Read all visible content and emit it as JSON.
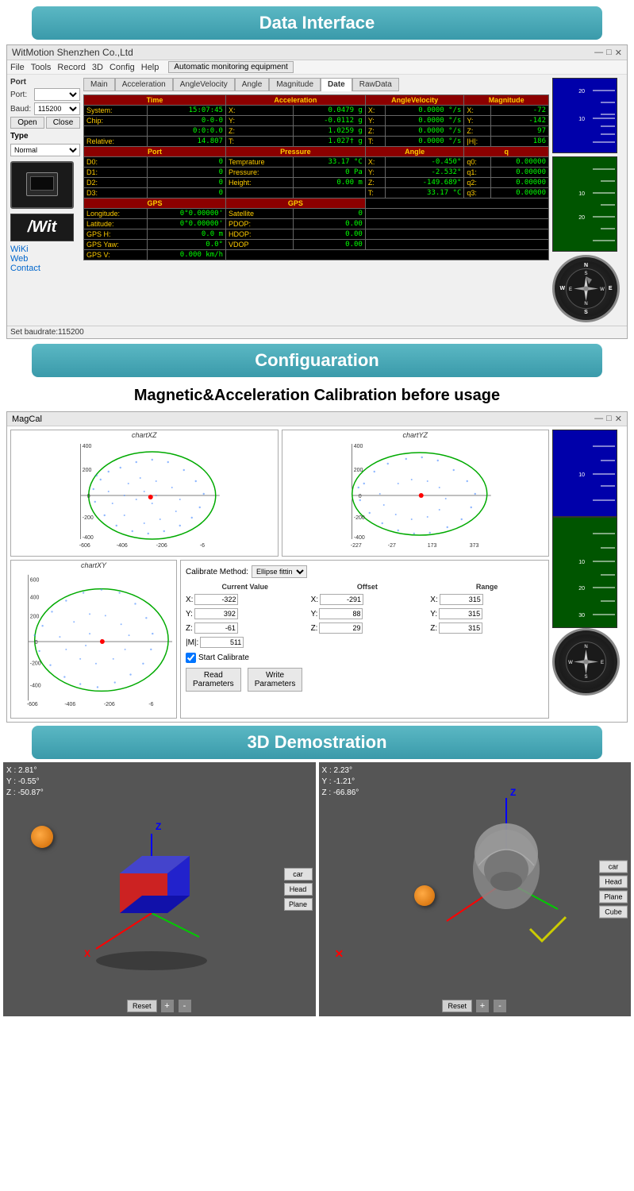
{
  "page": {
    "sections": [
      "Data Interface",
      "Configuaration",
      "3D Demostration"
    ]
  },
  "dataInterface": {
    "sectionTitle": "Data Interface",
    "window": {
      "title": "WitMotion Shenzhen Co.,Ltd",
      "controls": [
        "—",
        "□",
        "✕"
      ]
    },
    "menu": {
      "items": [
        "File",
        "Tools",
        "Record",
        "3D",
        "Config",
        "Help"
      ],
      "autoMonitor": "Automatic monitoring equipment"
    },
    "sidebar": {
      "portLabel": "Port",
      "portLabel2": "Port:",
      "baudLabel": "Baud:",
      "openBtn": "Open",
      "closeBtn": "Close",
      "typeLabel": "Type",
      "typeValue": "Normal",
      "links": [
        "WiKi",
        "Web",
        "Contact"
      ],
      "witLogo": "wit"
    },
    "tabs": [
      "Main",
      "Acceleration",
      "AngleVelocity",
      "Angle",
      "Magnitude",
      "Date",
      "RawData"
    ],
    "table": {
      "timeHeader": "Time",
      "accelHeader": "Acceleration",
      "angleVelHeader": "AngleVelocity",
      "magnitudeHeader": "Magnitude",
      "systemTime": "15:07:45",
      "chipTime": "0-0-0",
      "chipTime2": "0:0:0.0",
      "relativeTime": "14.807",
      "accelX": "0.0479 g",
      "accelY": "-0.0112 g",
      "accelZ": "1.0259 g",
      "accelT": "1.027† g",
      "angleVelX": "0.0000 °/s",
      "angleVelY": "0.0000 °/s",
      "angleVelZ": "0.0000 °/s",
      "angleVelT": "0.0000 °/s",
      "magX": "-72",
      "magY": "-142",
      "magZ": "97",
      "magH": "186",
      "portHeader": "Port",
      "pressureHeader": "Pressure",
      "angleHeader": "Angle",
      "qHeader": "q",
      "d0": "0",
      "d1": "0",
      "d2": "0",
      "d3": "0",
      "tempLabel": "Temprature",
      "tempValue": "33.17 °C",
      "pressLabel": "Pressure:",
      "pressValue": "0 Pa",
      "heightLabel": "Height:",
      "heightValue": "0.00 m",
      "angleX": "-0.450°",
      "angleY": "-2.532°",
      "angleZ": "-149.689°",
      "angleT": "33.17 °C",
      "q0": "0.00000",
      "q1": "0.00000",
      "q2": "0.00000",
      "q3": "0.00000",
      "gpsHeader": "GPS",
      "gpsHeader2": "GPS",
      "longitude": "0°0.00000'",
      "latitude": "0°0.00000'",
      "gpsH": "0.0 m",
      "gpsYaw": "0.0°",
      "gpsV": "0.000 km/h",
      "satellite": "0",
      "pdop": "0.00",
      "hdop": "0.00",
      "vdop": "0.00"
    },
    "statusBar": "Set baudrate:115200"
  },
  "configuration": {
    "sectionTitle": "Configuaration"
  },
  "calibration": {
    "title": "Magnetic&Acceleration Calibration before usage",
    "window": {
      "title": "MagCal",
      "controls": [
        "—",
        "□",
        "✕"
      ]
    },
    "charts": {
      "chartXZ": "chartXZ",
      "chartYZ": "chartYZ",
      "chartXY": "chartXY",
      "xzXAxis": [
        "-606",
        "-406",
        "-206",
        "-6"
      ],
      "xzYAxis": [
        "400",
        "200",
        "0",
        "-200",
        "-400"
      ],
      "yzXAxis": [
        "-227",
        "-27",
        "173",
        "373"
      ],
      "yzYAxis": [
        "400",
        "200",
        "0",
        "-200",
        "-400"
      ],
      "xyXAxis": [
        "-606",
        "-406",
        "-206",
        "-6"
      ],
      "xyYAxis": [
        "600",
        "400",
        "200",
        "0",
        "-200",
        "-400"
      ]
    },
    "calibPanel": {
      "methodLabel": "Calibrate Method:",
      "methodValue": "Ellipse fittin",
      "currentValueLabel": "Current Value",
      "offsetLabel": "Offset",
      "rangeLabel": "Range",
      "xLabel": "X:",
      "yLabel": "Y:",
      "zLabel": "Z:",
      "mLabel": "|M|:",
      "currentX": "-322",
      "currentY": "392",
      "currentZ": "-61",
      "currentM": "511",
      "offsetX": "-291",
      "offsetY": "88",
      "offsetZ": "29",
      "rangeX": "315",
      "rangeY": "315",
      "rangeZ": "315",
      "startCalibrate": "Start Calibrate",
      "readBtn": "Read\nParameters",
      "writeBtn": "Write\nParameters"
    }
  },
  "demo3d": {
    "sectionTitle": "3D Demostration",
    "leftPanel": {
      "coords": "X : 2.81°\nY : -0.55°\nZ : -50.87°",
      "buttons": [
        "car",
        "Head",
        "Plane"
      ],
      "resetBtn": "Reset",
      "plusBtn": "+",
      "minusBtn": "-"
    },
    "rightPanel": {
      "coords": "X : 2.23°\nY : -1.21°\nZ : -66.86°",
      "buttons": [
        "car",
        "Head",
        "Plane",
        "Cube"
      ],
      "resetBtn": "Reset",
      "plusBtn": "+",
      "minusBtn": "-"
    }
  }
}
